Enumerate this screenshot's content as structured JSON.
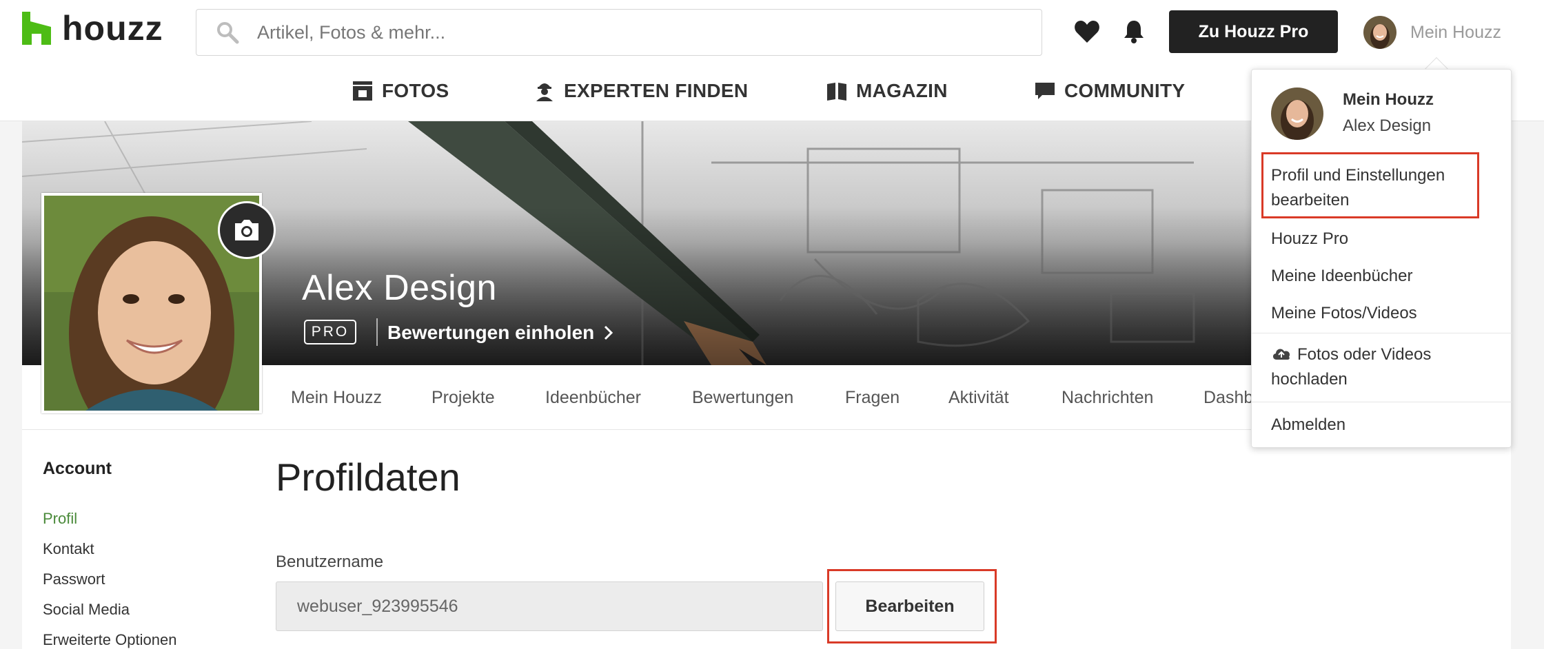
{
  "header": {
    "logo_text": "houzz",
    "search_placeholder": "Artikel, Fotos & mehr...",
    "pro_button": "Zu Houzz Pro",
    "user_menu_label": "Mein Houzz"
  },
  "nav": {
    "items": [
      {
        "label": "FOTOS",
        "icon": "photos-icon"
      },
      {
        "label": "EXPERTEN FINDEN",
        "icon": "expert-icon"
      },
      {
        "label": "MAGAZIN",
        "icon": "magazine-icon"
      },
      {
        "label": "COMMUNITY",
        "icon": "chat-icon"
      }
    ]
  },
  "profile": {
    "name": "Alex Design",
    "badge": "PRO",
    "reviews_link": "Bewertungen einholen"
  },
  "tabs": [
    "Mein Houzz",
    "Projekte",
    "Ideenbücher",
    "Bewertungen",
    "Fragen",
    "Aktivität",
    "Nachrichten",
    "Dashb"
  ],
  "sidebar": {
    "title": "Account",
    "items": [
      "Profil",
      "Kontakt",
      "Passwort",
      "Social Media",
      "Erweiterte Optionen"
    ],
    "active_index": 0
  },
  "main": {
    "title": "Profildaten",
    "username_label": "Benutzername",
    "username_value": "webuser_923995546",
    "edit_button": "Bearbeiten"
  },
  "dropdown": {
    "title": "Mein Houzz",
    "subtitle": "Alex Design",
    "items": [
      {
        "line1": "Profil und Einstellungen",
        "line2": "bearbeiten"
      },
      {
        "line1": "Houzz Pro"
      },
      {
        "line1": "Meine Ideenbücher"
      },
      {
        "line1": "Meine Fotos/Videos"
      },
      {
        "line1": "Fotos oder Videos",
        "line2": "hochladen"
      },
      {
        "line1": "Abmelden"
      }
    ]
  },
  "colors": {
    "brand_green": "#4dbc15",
    "highlight_red": "#d93a27",
    "active_link": "#4a8a3a",
    "dark_button": "#222222"
  }
}
